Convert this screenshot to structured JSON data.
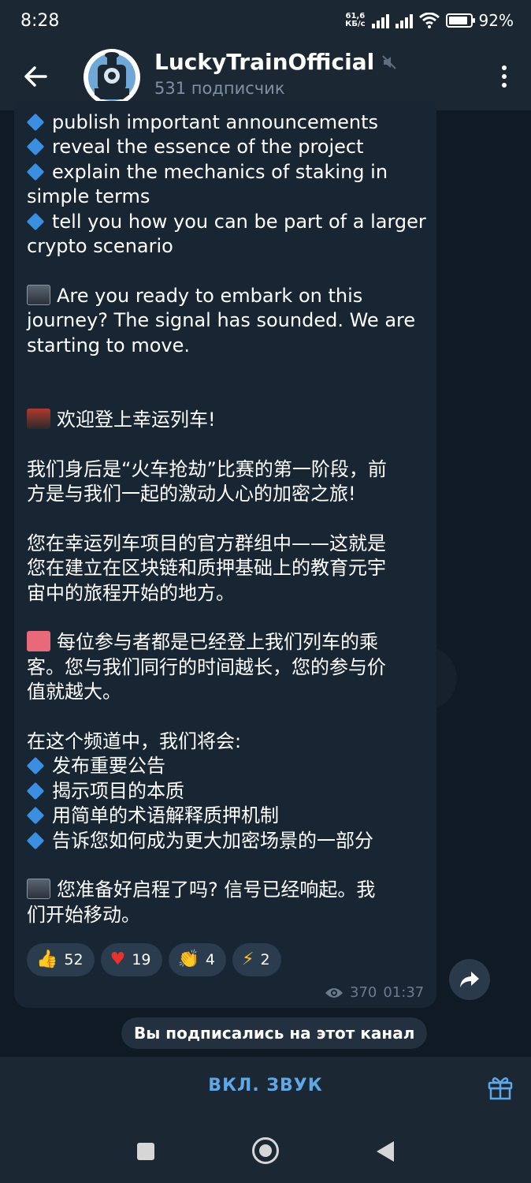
{
  "status_bar": {
    "time": "8:28",
    "net_speed_value": "61,6",
    "net_speed_unit": "КБ/с",
    "battery": "92%",
    "battery_level": 0.92
  },
  "header": {
    "title": "LuckyTrainOfficial",
    "subscribers": "531 подписчик"
  },
  "message": {
    "lines": [
      {
        "icon": "diamond",
        "text": "publish important announcements"
      },
      {
        "icon": "diamond",
        "text": "reveal the essence of the project"
      },
      {
        "icon": "diamond",
        "text": "explain the mechanics of staking in"
      },
      {
        "icon": "",
        "text": "simple terms"
      },
      {
        "icon": "diamond",
        "text": "tell you how you can be part of a larger"
      },
      {
        "icon": "",
        "text": "crypto scenario"
      },
      {
        "icon": "",
        "text": ""
      },
      {
        "icon": "train",
        "text": "Are you ready to embark on this"
      },
      {
        "icon": "",
        "text": "journey? The signal has sounded. We are"
      },
      {
        "icon": "",
        "text": "starting to move."
      },
      {
        "icon": "",
        "text": ""
      },
      {
        "icon": "",
        "text": ""
      },
      {
        "icon": "loco",
        "text": "欢迎登上幸运列车!"
      },
      {
        "icon": "",
        "text": ""
      },
      {
        "icon": "",
        "text": "我们身后是“火车抢劫”比赛的第一阶段，前"
      },
      {
        "icon": "",
        "text": "方是与我们一起的激动人心的加密之旅!"
      },
      {
        "icon": "",
        "text": ""
      },
      {
        "icon": "",
        "text": "您在幸运列车项目的官方群组中——这就是"
      },
      {
        "icon": "",
        "text": "您在建立在区块链和质押基础上的教育元宇"
      },
      {
        "icon": "",
        "text": "宙中的旅程开始的地方。"
      },
      {
        "icon": "",
        "text": ""
      },
      {
        "icon": "ticket",
        "text": "每位参与者都是已经登上我们列车的乘"
      },
      {
        "icon": "",
        "text": "客。您与我们同行的时间越长，您的参与价"
      },
      {
        "icon": "",
        "text": "值就越大。"
      },
      {
        "icon": "",
        "text": ""
      },
      {
        "icon": "",
        "text": "在这个频道中，我们将会:"
      },
      {
        "icon": "diamond",
        "text": "发布重要公告"
      },
      {
        "icon": "diamond",
        "text": "揭示项目的本质"
      },
      {
        "icon": "diamond",
        "text": "用简单的术语解释质押机制"
      },
      {
        "icon": "diamond",
        "text": "告诉您如何成为更大加密场景的一部分"
      },
      {
        "icon": "",
        "text": ""
      },
      {
        "icon": "train",
        "text": "您准备好启程了吗? 信号已经响起。我"
      },
      {
        "icon": "",
        "text": "们开始移动。"
      }
    ],
    "reactions": [
      {
        "emoji": "👍",
        "count": "52",
        "name": "thumbs-up"
      },
      {
        "emoji": "♥",
        "count": "19",
        "name": "heart"
      },
      {
        "emoji": "👏",
        "count": "4",
        "name": "clap"
      },
      {
        "emoji": "⚡",
        "count": "2",
        "name": "lightning"
      }
    ],
    "views": "370",
    "time": "01:37"
  },
  "service_message": "Вы подписались на этот канал",
  "bottom_bar": {
    "unmute_label": "ВКЛ. ЗВУК"
  }
}
